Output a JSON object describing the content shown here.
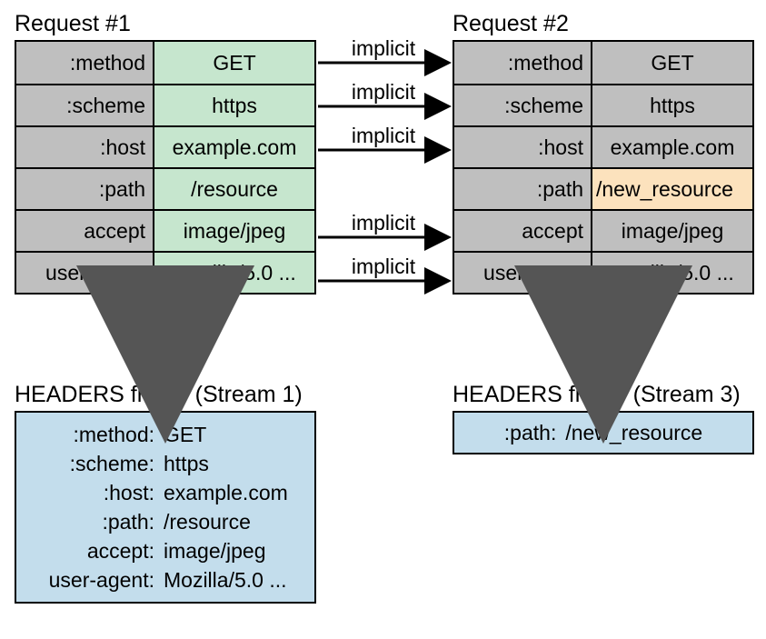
{
  "request1": {
    "title": "Request #1",
    "rows": [
      {
        "key": ":method",
        "value": "GET",
        "bg": "green"
      },
      {
        "key": ":scheme",
        "value": "https",
        "bg": "green"
      },
      {
        "key": ":host",
        "value": "example.com",
        "bg": "green"
      },
      {
        "key": ":path",
        "value": "/resource",
        "bg": "green"
      },
      {
        "key": "accept",
        "value": "image/jpeg",
        "bg": "green"
      },
      {
        "key": "user-agent",
        "value": "Mozilla/5.0 ...",
        "bg": "green"
      }
    ]
  },
  "request2": {
    "title": "Request #2",
    "rows": [
      {
        "key": ":method",
        "value": "GET",
        "key_bg": "gray",
        "bg": "gray"
      },
      {
        "key": ":scheme",
        "value": "https",
        "key_bg": "gray",
        "bg": "gray"
      },
      {
        "key": ":host",
        "value": "example.com",
        "key_bg": "gray",
        "bg": "gray"
      },
      {
        "key": ":path",
        "value": "/new_resource",
        "key_bg": "tan",
        "bg": "tan"
      },
      {
        "key": "accept",
        "value": "image/jpeg",
        "key_bg": "gray",
        "bg": "gray"
      },
      {
        "key": "user-agent",
        "value": "Mozilla/5.0 ...",
        "key_bg": "gray",
        "bg": "gray"
      }
    ]
  },
  "arrows": {
    "implicit": "implicit"
  },
  "frame1": {
    "title": "HEADERS frame (Stream 1)",
    "lines": [
      {
        "key": ":method:",
        "value": "GET"
      },
      {
        "key": ":scheme:",
        "value": "https"
      },
      {
        "key": ":host:",
        "value": "example.com"
      },
      {
        "key": ":path:",
        "value": "/resource"
      },
      {
        "key": "accept:",
        "value": "image/jpeg"
      },
      {
        "key": "user-agent:",
        "value": "Mozilla/5.0 ..."
      }
    ]
  },
  "frame2": {
    "title": "HEADERS frame (Stream 3)",
    "lines": [
      {
        "key": ":path:",
        "value": "/new_resource"
      }
    ]
  }
}
